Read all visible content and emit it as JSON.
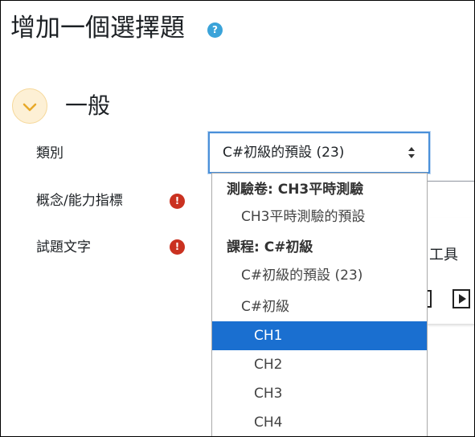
{
  "page": {
    "title": "增加一個選擇題",
    "help_icon": "?"
  },
  "section": {
    "title": "一般"
  },
  "form": {
    "category_label": "類別",
    "concept_label": "概念/能力指標",
    "question_text_label": "試題文字",
    "required_icon": "!",
    "category_value": "C#初級的預設 (23)"
  },
  "editor": {
    "tools_label": "工具"
  },
  "dropdown": {
    "items": [
      {
        "label": "測驗卷: CH3平時測驗",
        "kind": "group"
      },
      {
        "label": "CH3平時測驗的預設",
        "kind": "option"
      },
      {
        "label": "課程: C#初級",
        "kind": "group"
      },
      {
        "label": "C#初級的預設 (23)",
        "kind": "option"
      },
      {
        "label": "C#初級",
        "kind": "option"
      },
      {
        "label": "CH1",
        "kind": "suboption",
        "selected": true
      },
      {
        "label": "CH2",
        "kind": "suboption"
      },
      {
        "label": "CH3",
        "kind": "suboption"
      },
      {
        "label": "CH4",
        "kind": "suboption"
      }
    ]
  },
  "colors": {
    "selected_bg": "#1a6fd0",
    "focus_border": "#4a90d9",
    "required_red": "#ca3120",
    "help_blue": "#3aa3d9",
    "collapse_bg": "#fdf0d5",
    "chevron": "#e8a92a"
  }
}
